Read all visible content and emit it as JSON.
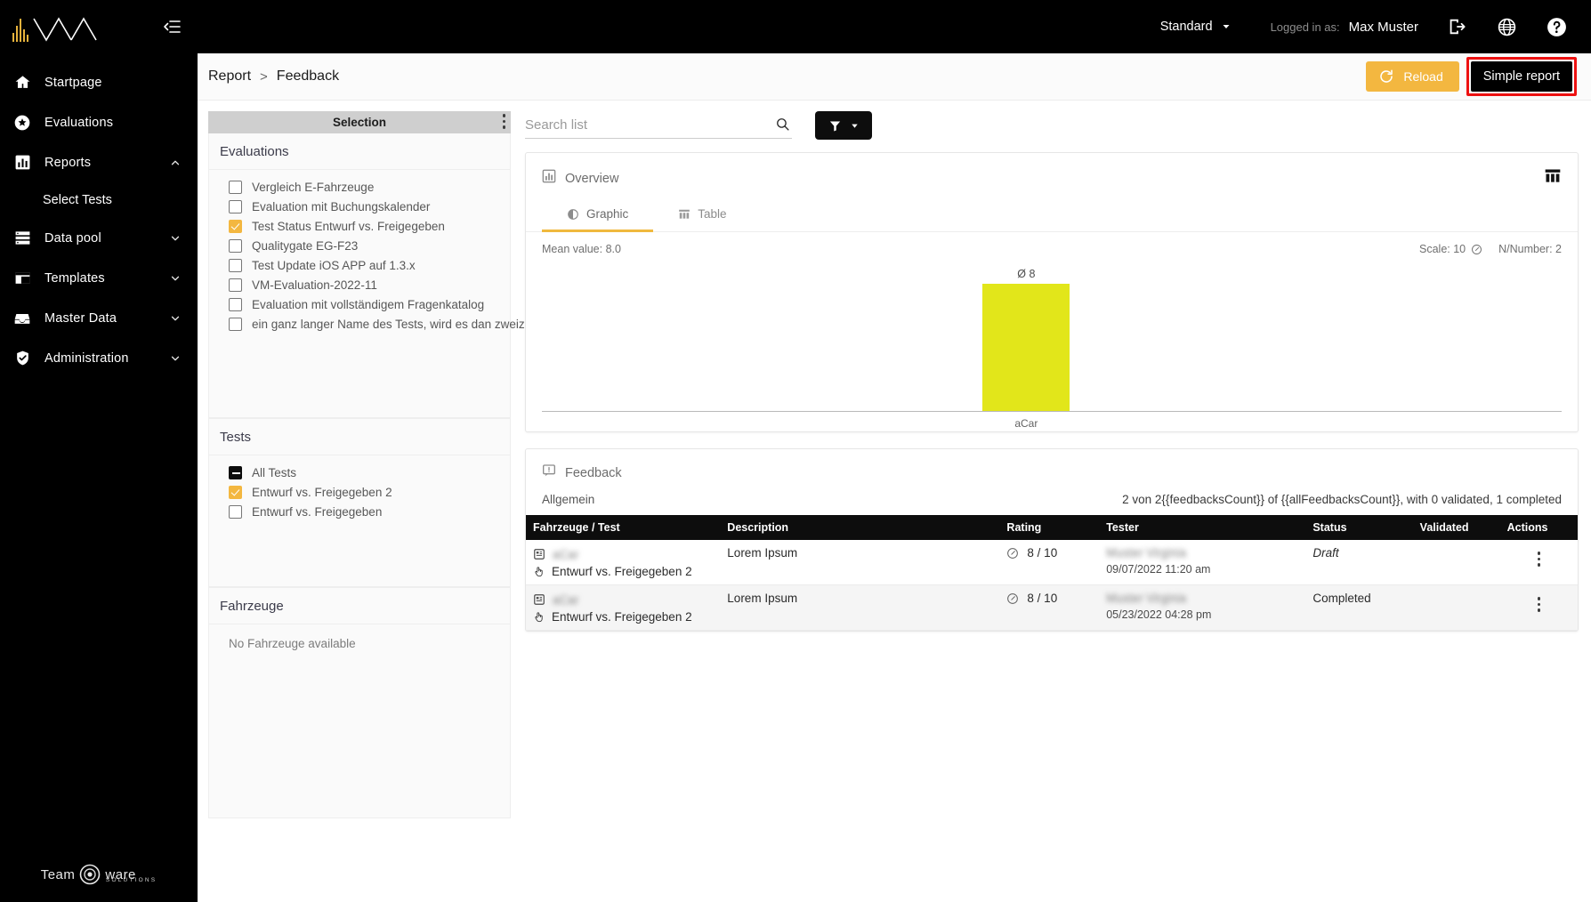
{
  "sidebar": {
    "brand_logo": "wave-logo",
    "collapse_icon": "collapse-sidebar-icon",
    "items": [
      {
        "label": "Startpage",
        "icon": "home-icon",
        "chevron": ""
      },
      {
        "label": "Evaluations",
        "icon": "star-icon",
        "chevron": ""
      },
      {
        "label": "Reports",
        "icon": "bar-chart-icon",
        "chevron": "chevron-up-icon"
      },
      {
        "label": "Data pool",
        "icon": "list-icon",
        "chevron": "chevron-down-icon"
      },
      {
        "label": "Templates",
        "icon": "layout-icon",
        "chevron": "chevron-down-icon"
      },
      {
        "label": "Master Data",
        "icon": "inbox-icon",
        "chevron": "chevron-down-icon"
      },
      {
        "label": "Administration",
        "icon": "shield-check-icon",
        "chevron": "chevron-down-icon"
      }
    ],
    "sub_item": "Select Tests",
    "footer": {
      "name_left": "Team",
      "name_right": "ware",
      "tagline": "SOLUTIONS"
    }
  },
  "topbar": {
    "mode_select": "Standard",
    "logged_in_label": "Logged in as:",
    "user_name": "Max Muster",
    "logout_icon": "logout-icon",
    "language_icon": "globe-icon",
    "help_icon": "help-icon"
  },
  "breadcrumb": {
    "root": "Report",
    "separator": ">",
    "current": "Feedback"
  },
  "actions": {
    "reload_label": "Reload",
    "reload_icon": "refresh-icon",
    "simple_report_label": "Simple report",
    "highlight_color": "#ee1111"
  },
  "selection": {
    "header": "Selection",
    "kebab_icon": "more-vertical-icon",
    "groups": [
      {
        "title": "Evaluations",
        "items": [
          {
            "label": "Vergleich E-Fahrzeuge",
            "state": "unchecked"
          },
          {
            "label": "Evaluation mit Buchungskalender",
            "state": "unchecked"
          },
          {
            "label": "Test Status Entwurf vs. Freigegeben",
            "state": "checked"
          },
          {
            "label": "Qualitygate EG-F23",
            "state": "unchecked"
          },
          {
            "label": "Test Update iOS APP auf 1.3.x",
            "state": "unchecked"
          },
          {
            "label": "VM-Evaluation-2022-11",
            "state": "unchecked"
          },
          {
            "label": "Evaluation mit vollständigem Fragenkatalog",
            "state": "unchecked"
          },
          {
            "label": "ein ganz langer Name des Tests, wird es dan zweizeilig",
            "state": "unchecked"
          }
        ]
      },
      {
        "title": "Tests",
        "items": [
          {
            "label": "All Tests",
            "state": "indeterminate"
          },
          {
            "label": "Entwurf vs. Freigegeben 2",
            "state": "checked"
          },
          {
            "label": "Entwurf vs. Freigegeben",
            "state": "unchecked"
          }
        ]
      },
      {
        "title": "Fahrzeuge",
        "empty_text": "No Fahrzeuge available",
        "items": []
      }
    ]
  },
  "search": {
    "placeholder": "Search list",
    "value": "",
    "icon": "search-icon"
  },
  "filter_button": {
    "icon": "funnel-icon",
    "caret": "caret-down-icon"
  },
  "overview": {
    "title": "Overview",
    "icon": "bar-chart-icon",
    "columns_icon": "table-columns-icon",
    "tabs": [
      {
        "label": "Graphic",
        "icon": "pie-icon",
        "active": true
      },
      {
        "label": "Table",
        "icon": "table-icon",
        "active": false
      }
    ],
    "mean_text": "Mean value: 8.0",
    "scale_text": "Scale: 10",
    "scale_icon": "gauge-icon",
    "n_number_text": "N/Number: 2"
  },
  "chart_data": {
    "type": "bar",
    "categories": [
      "aCar"
    ],
    "values": [
      8
    ],
    "data_labels": [
      "Ø 8"
    ],
    "title": "Overview",
    "xlabel": "",
    "ylabel": "",
    "ylim": [
      0,
      10
    ],
    "grid": false,
    "legend": "none",
    "bar_color": "#e2e61a",
    "mean_value": 8.0,
    "scale_max": 10,
    "n_number": 2
  },
  "feedback": {
    "title": "Feedback",
    "icon": "feedback-icon",
    "section_label": "Allgemein",
    "count_text": "2 von 2{{feedbacksCount}} of {{allFeedbacksCount}}, with 0 validated, 1 completed",
    "columns": [
      "Fahrzeuge / Test",
      "Description",
      "Rating",
      "Tester",
      "Status",
      "Validated",
      "Actions"
    ],
    "rows": [
      {
        "vehicle": "aCar",
        "vehicle_redacted": true,
        "vehicle_icon": "vehicle-icon",
        "test": "Entwurf vs. Freigegeben 2",
        "test_icon": "hand-pointer-icon",
        "description": "Lorem Ipsum",
        "rating": "8 / 10",
        "rating_icon": "gauge-icon",
        "tester": "Muster Virginia",
        "tester_redacted": true,
        "tester_date": "09/07/2022 11:20 am",
        "status": "Draft",
        "status_style": "italic",
        "validated": "",
        "actions_icon": "more-vertical-icon"
      },
      {
        "vehicle": "aCar",
        "vehicle_redacted": true,
        "vehicle_icon": "vehicle-icon",
        "test": "Entwurf vs. Freigegeben 2",
        "test_icon": "hand-pointer-icon",
        "description": "Lorem Ipsum",
        "rating": "8 / 10",
        "rating_icon": "gauge-icon",
        "tester": "Muster Virginia",
        "tester_redacted": true,
        "tester_date": "05/23/2022 04:28 pm",
        "status": "Completed",
        "status_style": "normal",
        "validated": "",
        "actions_icon": "more-vertical-icon"
      }
    ]
  }
}
